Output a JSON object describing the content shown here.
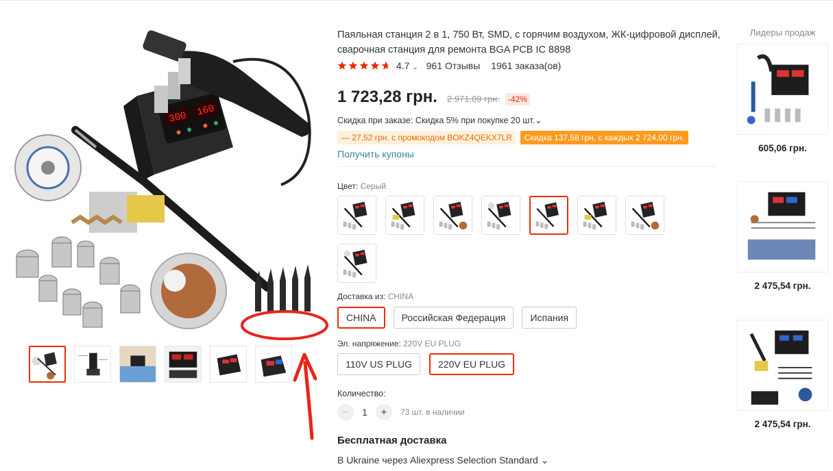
{
  "product": {
    "title": "Паяльная станция 2 в 1, 750 Вт, SMD, с горячим воздухом, ЖК-цифровой дисплей, сварочная станция для ремонта BGA PCB IC 8898",
    "rating": "4.7",
    "rating_stars": 4.7,
    "reviews": "961 Отзывы",
    "orders": "1961 заказа(ов)",
    "price": "1 723,28 грн.",
    "old_price": "2 971,09 грн.",
    "discount": "-42%",
    "bulk_discount": "Скидка при заказе: Скидка 5% при покупке 20 шт.",
    "promo_code": "— 27,52 грн. с промокодом BOKZ4QEKX7LR",
    "promo_threshold": "Скидка 137,58 грн. с каждых 2 724,00 грн.",
    "get_coupons": "Получить купоны",
    "display_text": {
      "left": "300",
      "right": "160",
      "brand": "GUDCJI"
    }
  },
  "options": {
    "color_label": "Цвет:",
    "color_value": "Серый",
    "color_count": 8,
    "color_selected_index": 4,
    "ship_from_label": "Доставка из:",
    "ship_from_value": "CHINA",
    "ship_from": [
      "CHINA",
      "Российская Федерация",
      "Испания"
    ],
    "ship_from_selected": 0,
    "voltage_label": "Эл. напряжение:",
    "voltage_value": "220V EU PLUG",
    "voltages": [
      "110V US PLUG",
      "220V EU PLUG"
    ],
    "voltage_selected": 1
  },
  "quantity": {
    "label": "Количество:",
    "minus": "−",
    "value": "1",
    "plus": "+",
    "stock": "73 шт. в наличии"
  },
  "shipping": {
    "free": "Бесплатная доставка",
    "method": "В Ukraine через Aliexpress Selection Standard"
  },
  "sidebar": {
    "title": "Лидеры продаж",
    "items": [
      {
        "price": "605,06 грн."
      },
      {
        "price": "2 475,54 грн."
      },
      {
        "price": "2 475,54 грн."
      }
    ]
  },
  "colors": {
    "accent": "#e62e04",
    "link": "#3a7ea8",
    "star": "#e62e04",
    "annotation": "#e8251a"
  }
}
